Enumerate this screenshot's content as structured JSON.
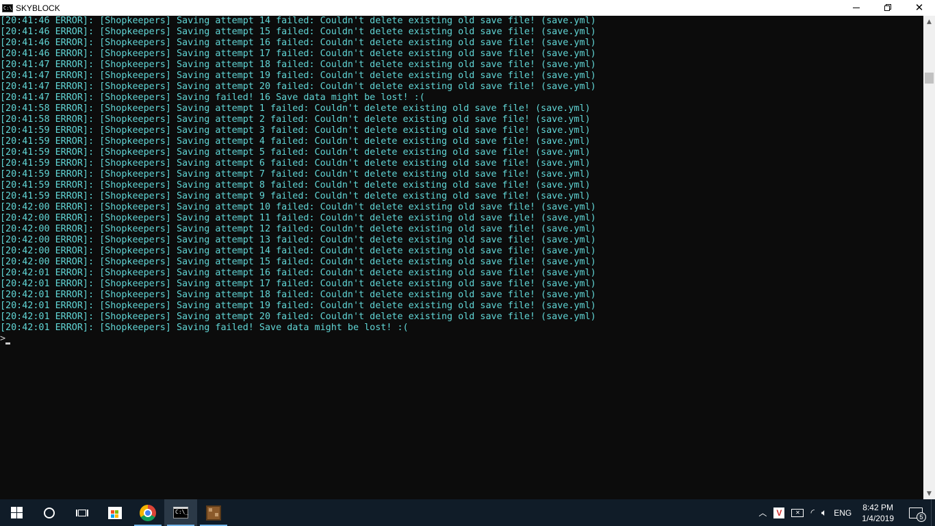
{
  "window": {
    "title": "SKYBLOCK",
    "icon": "console-icon",
    "controls": {
      "minimize": "minimize-icon",
      "restore": "restore-icon",
      "close": "close-icon"
    }
  },
  "console": {
    "text_color": "#61d6d6",
    "background": "#0c0c0c",
    "lines": [
      "[20:41:46 ERROR]: [Shopkeepers] Saving attempt 14 failed: Couldn't delete existing old save file! (save.yml)",
      "[20:41:46 ERROR]: [Shopkeepers] Saving attempt 15 failed: Couldn't delete existing old save file! (save.yml)",
      "[20:41:46 ERROR]: [Shopkeepers] Saving attempt 16 failed: Couldn't delete existing old save file! (save.yml)",
      "[20:41:46 ERROR]: [Shopkeepers] Saving attempt 17 failed: Couldn't delete existing old save file! (save.yml)",
      "[20:41:47 ERROR]: [Shopkeepers] Saving attempt 18 failed: Couldn't delete existing old save file! (save.yml)",
      "[20:41:47 ERROR]: [Shopkeepers] Saving attempt 19 failed: Couldn't delete existing old save file! (save.yml)",
      "[20:41:47 ERROR]: [Shopkeepers] Saving attempt 20 failed: Couldn't delete existing old save file! (save.yml)",
      "[20:41:47 ERROR]: [Shopkeepers] Saving failed! 16 Save data might be lost! :(",
      "[20:41:58 ERROR]: [Shopkeepers] Saving attempt 1 failed: Couldn't delete existing old save file! (save.yml)",
      "[20:41:58 ERROR]: [Shopkeepers] Saving attempt 2 failed: Couldn't delete existing old save file! (save.yml)",
      "[20:41:59 ERROR]: [Shopkeepers] Saving attempt 3 failed: Couldn't delete existing old save file! (save.yml)",
      "[20:41:59 ERROR]: [Shopkeepers] Saving attempt 4 failed: Couldn't delete existing old save file! (save.yml)",
      "[20:41:59 ERROR]: [Shopkeepers] Saving attempt 5 failed: Couldn't delete existing old save file! (save.yml)",
      "[20:41:59 ERROR]: [Shopkeepers] Saving attempt 6 failed: Couldn't delete existing old save file! (save.yml)",
      "[20:41:59 ERROR]: [Shopkeepers] Saving attempt 7 failed: Couldn't delete existing old save file! (save.yml)",
      "[20:41:59 ERROR]: [Shopkeepers] Saving attempt 8 failed: Couldn't delete existing old save file! (save.yml)",
      "[20:41:59 ERROR]: [Shopkeepers] Saving attempt 9 failed: Couldn't delete existing old save file! (save.yml)",
      "[20:42:00 ERROR]: [Shopkeepers] Saving attempt 10 failed: Couldn't delete existing old save file! (save.yml)",
      "[20:42:00 ERROR]: [Shopkeepers] Saving attempt 11 failed: Couldn't delete existing old save file! (save.yml)",
      "[20:42:00 ERROR]: [Shopkeepers] Saving attempt 12 failed: Couldn't delete existing old save file! (save.yml)",
      "[20:42:00 ERROR]: [Shopkeepers] Saving attempt 13 failed: Couldn't delete existing old save file! (save.yml)",
      "[20:42:00 ERROR]: [Shopkeepers] Saving attempt 14 failed: Couldn't delete existing old save file! (save.yml)",
      "[20:42:00 ERROR]: [Shopkeepers] Saving attempt 15 failed: Couldn't delete existing old save file! (save.yml)",
      "[20:42:01 ERROR]: [Shopkeepers] Saving attempt 16 failed: Couldn't delete existing old save file! (save.yml)",
      "[20:42:01 ERROR]: [Shopkeepers] Saving attempt 17 failed: Couldn't delete existing old save file! (save.yml)",
      "[20:42:01 ERROR]: [Shopkeepers] Saving attempt 18 failed: Couldn't delete existing old save file! (save.yml)",
      "[20:42:01 ERROR]: [Shopkeepers] Saving attempt 19 failed: Couldn't delete existing old save file! (save.yml)",
      "[20:42:01 ERROR]: [Shopkeepers] Saving attempt 20 failed: Couldn't delete existing old save file! (save.yml)",
      "[20:42:01 ERROR]: [Shopkeepers] Saving failed! Save data might be lost! :("
    ],
    "prompt": ">"
  },
  "taskbar": {
    "apps": [
      {
        "name": "start",
        "icon": "windows-logo-icon",
        "active": false
      },
      {
        "name": "cortana",
        "icon": "cortana-circle-icon",
        "active": false
      },
      {
        "name": "task-view",
        "icon": "task-view-icon",
        "active": false
      },
      {
        "name": "store",
        "icon": "microsoft-store-icon",
        "active": false
      },
      {
        "name": "chrome",
        "icon": "chrome-icon",
        "active": false
      },
      {
        "name": "command-prompt",
        "icon": "command-prompt-icon",
        "active": true
      },
      {
        "name": "minecraft",
        "icon": "minecraft-icon",
        "active": false
      }
    ],
    "tray": {
      "language": "ENG",
      "time": "8:42 PM",
      "date": "1/4/2019",
      "notification_count": "5"
    },
    "accent": "#76b9ed",
    "background": "#101c28"
  }
}
